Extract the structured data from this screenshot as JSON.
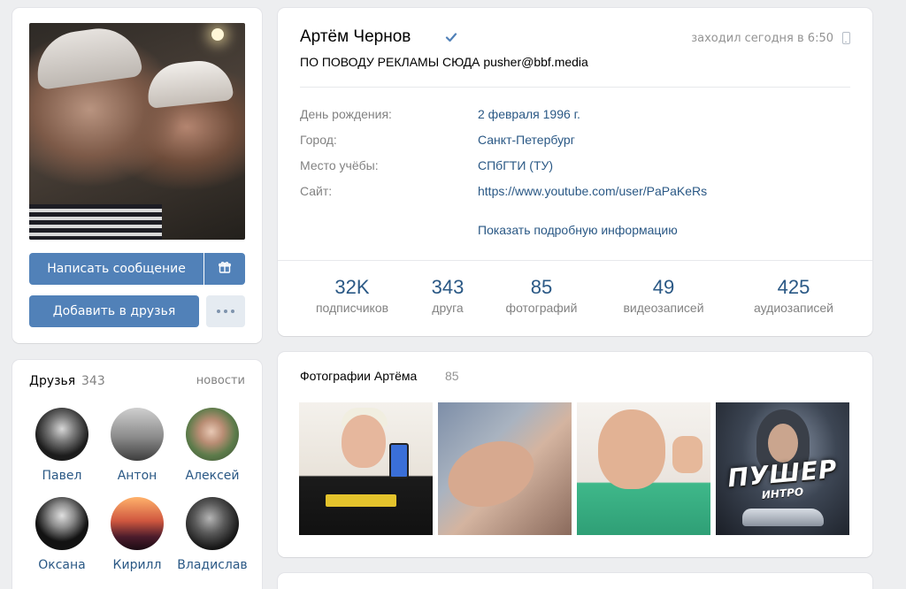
{
  "profile": {
    "name": "Артём Чернов",
    "status": "ПО ПОВОДУ РЕКЛАМЫ СЮДА pusher@bbf.media",
    "last_seen": "заходил сегодня в 6:50",
    "details": [
      {
        "label": "День рождения:",
        "value": "2 февраля 1996 г."
      },
      {
        "label": "Город:",
        "value": "Санкт-Петербург"
      },
      {
        "label": "Место учёбы:",
        "value": "СПбГТИ (ТУ)"
      },
      {
        "label": "Сайт:",
        "value": "https://www.youtube.com/user/PaPaKeRs"
      }
    ],
    "show_more": "Показать подробную информацию"
  },
  "counters": [
    {
      "value": "32K",
      "label": "подписчиков"
    },
    {
      "value": "343",
      "label": "друга"
    },
    {
      "value": "85",
      "label": "фотографий"
    },
    {
      "value": "49",
      "label": "видеозаписей"
    },
    {
      "value": "425",
      "label": "аудиозаписей"
    }
  ],
  "actions": {
    "write_message": "Написать сообщение",
    "add_friend": "Добавить в друзья"
  },
  "friends": {
    "title": "Друзья",
    "count": "343",
    "news_link": "новости",
    "items": [
      {
        "name": "Павел"
      },
      {
        "name": "Антон"
      },
      {
        "name": "Алексей"
      },
      {
        "name": "Оксана"
      },
      {
        "name": "Кирилл"
      },
      {
        "name": "Владислав"
      }
    ]
  },
  "photos": {
    "title": "Фотографии Артёма",
    "count": "85",
    "thumb4_title": "ПУШЕР",
    "thumb4_subtitle": "ИНТРО"
  },
  "icons": {
    "verified": "verified-check-icon",
    "phone": "mobile-phone-icon",
    "gift": "gift-icon",
    "more": "more-dots-icon"
  },
  "colors": {
    "accent": "#5181b8",
    "link": "#2a5885",
    "background": "#edeef0",
    "muted_text": "#828282"
  }
}
